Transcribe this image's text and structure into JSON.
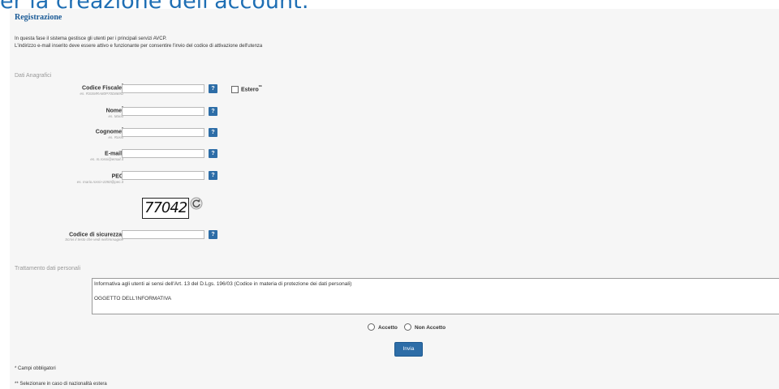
{
  "window": {
    "cropped_heading": "er la creazione dell'account:"
  },
  "page": {
    "title": "Registrazione",
    "intro_line1": "In questa fase il sistema gestisce gli utenti per i principali servizi AVCP.",
    "intro_line2": "L'indirizzo e-mail inserito deve essere attivo e funzionante per consentire l'invio del codice di attivazione dell'utenza"
  },
  "anagrafici": {
    "section_title": "Dati Anagrafici",
    "fields": [
      {
        "label": "Codice Fiscale",
        "required_mark": "*",
        "hint": "es. RSSMRA80P70D869U",
        "value": ""
      },
      {
        "label": "Nome",
        "required_mark": "*",
        "hint": "es. Mario",
        "value": ""
      },
      {
        "label": "Cognome",
        "required_mark": "*",
        "hint": "es. Rossi",
        "value": ""
      },
      {
        "label": "E-mail",
        "required_mark": "*",
        "hint": "es. m.rossi@email.it",
        "value": ""
      },
      {
        "label": "PEC",
        "required_mark": "",
        "hint": "es. mario.rossi+1050@pec.it",
        "value": ""
      }
    ],
    "estero_label": "Estero",
    "estero_mark": "**",
    "help_label": "?"
  },
  "captcha": {
    "image_text": "77042",
    "label": "Codice di sicurezza",
    "required_mark": "*",
    "hint": "Scrivi il testo che vedi nell'immagine",
    "value": ""
  },
  "privacy": {
    "section_title": "Trattamento dati personali",
    "text_line1": "Informativa agli utenti ai sensi dell'Art. 13 del D.Lgs. 196/03 (Codice in materia di protezione dei dati personali)",
    "text_line2": "OGGETTO DELL'INFORMATIVA",
    "accept_label": "Accetto",
    "reject_label": "Non Accetto"
  },
  "submit_label": "Invia",
  "footnotes": {
    "required": "* Campi obbligatori",
    "foreign": "** Selezionare in caso di nazionalità estera"
  },
  "colors": {
    "accent": "#2d6da7",
    "title": "#1a5a96"
  }
}
